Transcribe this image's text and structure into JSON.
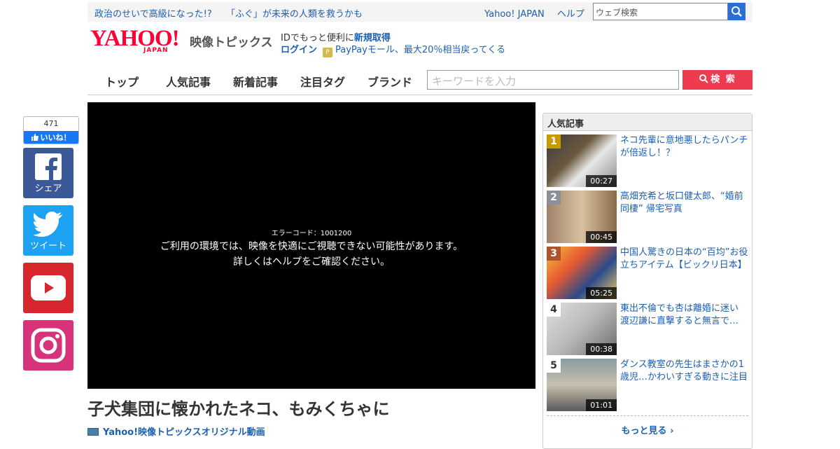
{
  "topbar": {
    "hot_links": [
      "政治のせいで高級になった!?",
      "「ふぐ」が未来の人類を救うかも"
    ],
    "links": [
      "Yahoo! JAPAN",
      "ヘルプ"
    ],
    "search_placeholder": "ウェブ検索"
  },
  "logo": {
    "main": "YAHOO!",
    "sub": "JAPAN",
    "service": "映像トピックス"
  },
  "account": {
    "id_text": "IDでもっと便利に",
    "register": "新規取得",
    "login": "ログイン",
    "paypay_promo": "PayPayモール、最大20％相当戻ってくる"
  },
  "nav": {
    "items": [
      "トップ",
      "人気記事",
      "新着記事",
      "注目タグ",
      "ブランド"
    ],
    "search_placeholder": "キーワードを入力",
    "search_button": "検 索"
  },
  "social": {
    "like_count": "471",
    "like_label": "いいね！",
    "facebook_label": "シェア",
    "twitter_label": "ツイート"
  },
  "video": {
    "error_code": "エラーコード：1001200",
    "message_line1": "ご利用の環境では、映像を快適にご視聴できない可能性があります。",
    "message_line2": "詳しくはヘルプをご確認ください。"
  },
  "article": {
    "title": "子犬集団に懐かれたネコ、もみくちゃに",
    "source": "Yahoo!映像トピックスオリジナル動画"
  },
  "ranking": {
    "header": "人気記事",
    "items": [
      {
        "rank": "1",
        "title": "ネコ先輩に意地悪したらパンチが倍返し！？",
        "duration": "00:27"
      },
      {
        "rank": "2",
        "title": "高畑充希と坂口健太郎、“婚前同棲” 帰宅写真",
        "duration": "00:45"
      },
      {
        "rank": "3",
        "title": "中国人驚きの日本の“百均”お役立ちアイテム【ビックリ日本】",
        "duration": "05:25"
      },
      {
        "rank": "4",
        "title": "東出不倫でも杏は離婚に迷い 渡辺謙に直撃すると無言で…",
        "duration": "00:38"
      },
      {
        "rank": "5",
        "title": "ダンス教室の先生はまさかの1歳児…かわいすぎる動きに注目",
        "duration": "01:01"
      }
    ],
    "more": "もっと見る"
  },
  "colors": {
    "link": "#1a5fb0",
    "brand_red": "#ff0033",
    "search_red": "#ef3b4f",
    "rank1": "#c89a00",
    "rank2": "#8a8f9a",
    "rank3": "#b0522a"
  }
}
